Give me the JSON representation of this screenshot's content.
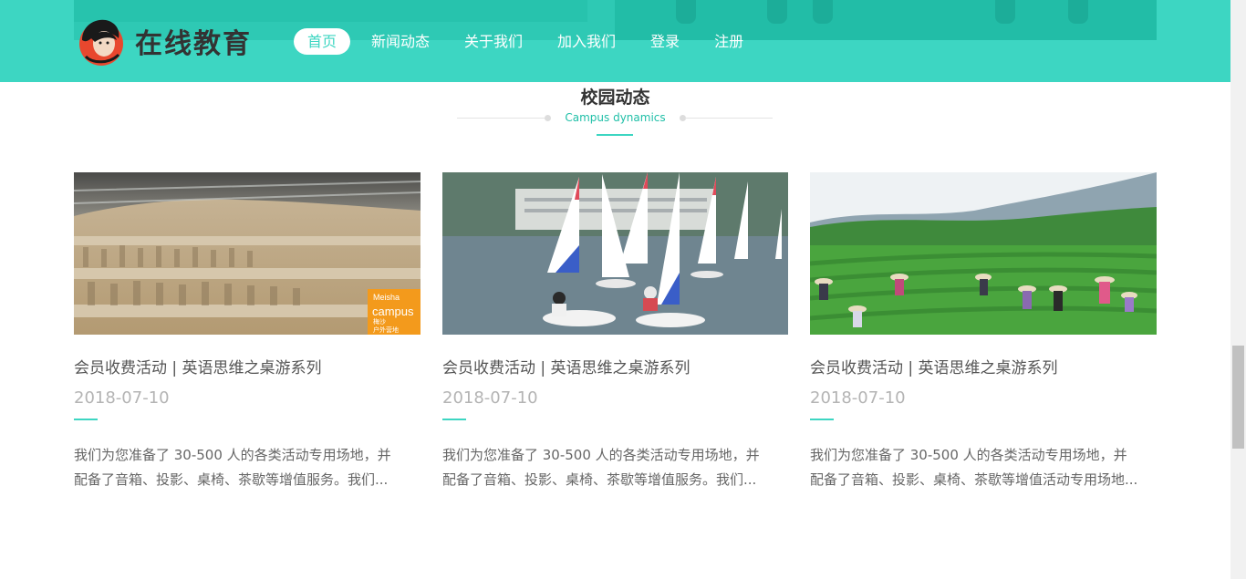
{
  "header": {
    "logo_text": "在线教育",
    "nav": [
      {
        "label": "首页",
        "active": true
      },
      {
        "label": "新闻动态",
        "active": false
      },
      {
        "label": "关于我们",
        "active": false
      },
      {
        "label": "加入我们",
        "active": false
      },
      {
        "label": "登录",
        "active": false
      },
      {
        "label": "注册",
        "active": false
      }
    ]
  },
  "section": {
    "title": "校园动态",
    "subtitle": "Campus dynamics"
  },
  "cards": [
    {
      "image": "terracotta-warriors-photo",
      "badge": {
        "line1": "Meisha",
        "line2": "campus",
        "line3": "梅沙",
        "line4": "户外营地"
      },
      "title": "会员收费活动 | 英语思维之桌游系列",
      "date": "2018-07-10",
      "desc_line1": "我们为您准备了 30-500 人的各类活动专用场地，并",
      "desc_line2": "配备了音箱、投影、桌椅、茶歇等增值服务。我们..."
    },
    {
      "image": "sailing-boats-photo",
      "title": "会员收费活动 | 英语思维之桌游系列",
      "date": "2018-07-10",
      "desc_line1": "我们为您准备了 30-500 人的各类活动专用场地，并",
      "desc_line2": "配备了音箱、投影、桌椅、茶歇等增值服务。我们..."
    },
    {
      "image": "tea-plantation-photo",
      "title": "会员收费活动 | 英语思维之桌游系列",
      "date": "2018-07-10",
      "desc_line1": "我们为您准备了 30-500 人的各类活动专用场地，并",
      "desc_line2": "配备了音箱、投影、桌椅、茶歇等增值活动专用场地..."
    }
  ],
  "colors": {
    "accent": "#3dd6c2",
    "accent_text": "#1fbfa7",
    "title_text": "#555555",
    "date_text": "#b4b4b4"
  }
}
